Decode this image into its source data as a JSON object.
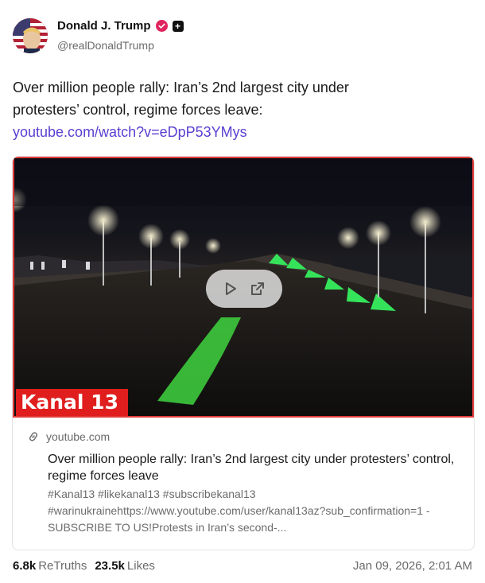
{
  "author": {
    "display_name": "Donald J. Trump",
    "handle": "@realDonaldTrump",
    "verified_color": "#e0245e"
  },
  "post": {
    "text": "Over million people rally: Iran’s 2nd largest city under protesters’ control, regime forces leave: ",
    "link_text": "youtube.com/watch?v=eDpP53YMys"
  },
  "video": {
    "overlay_label": "Kanal 13",
    "controls": [
      "play-icon",
      "external-link-icon"
    ]
  },
  "link_card": {
    "domain": "youtube.com",
    "title": "Over million people rally: Iran’s 2nd largest city under protesters’ control, regime forces leave",
    "description": "#Kanal13 #likekanal13 #subscribekanal13 #warinukrainehttps://www.youtube.com/user/kanal13az?sub_confirmation=1 - SUBSCRIBE TO US!Protests in Iran’s second-..."
  },
  "stats": {
    "retruths_count": "6.8k",
    "retruths_label": "ReTruths",
    "likes_count": "23.5k",
    "likes_label": "Likes"
  },
  "timestamp": "Jan 09, 2026, 2:01 AM",
  "colors": {
    "link": "#5b3fd1",
    "accent_red": "#e01e1e"
  }
}
